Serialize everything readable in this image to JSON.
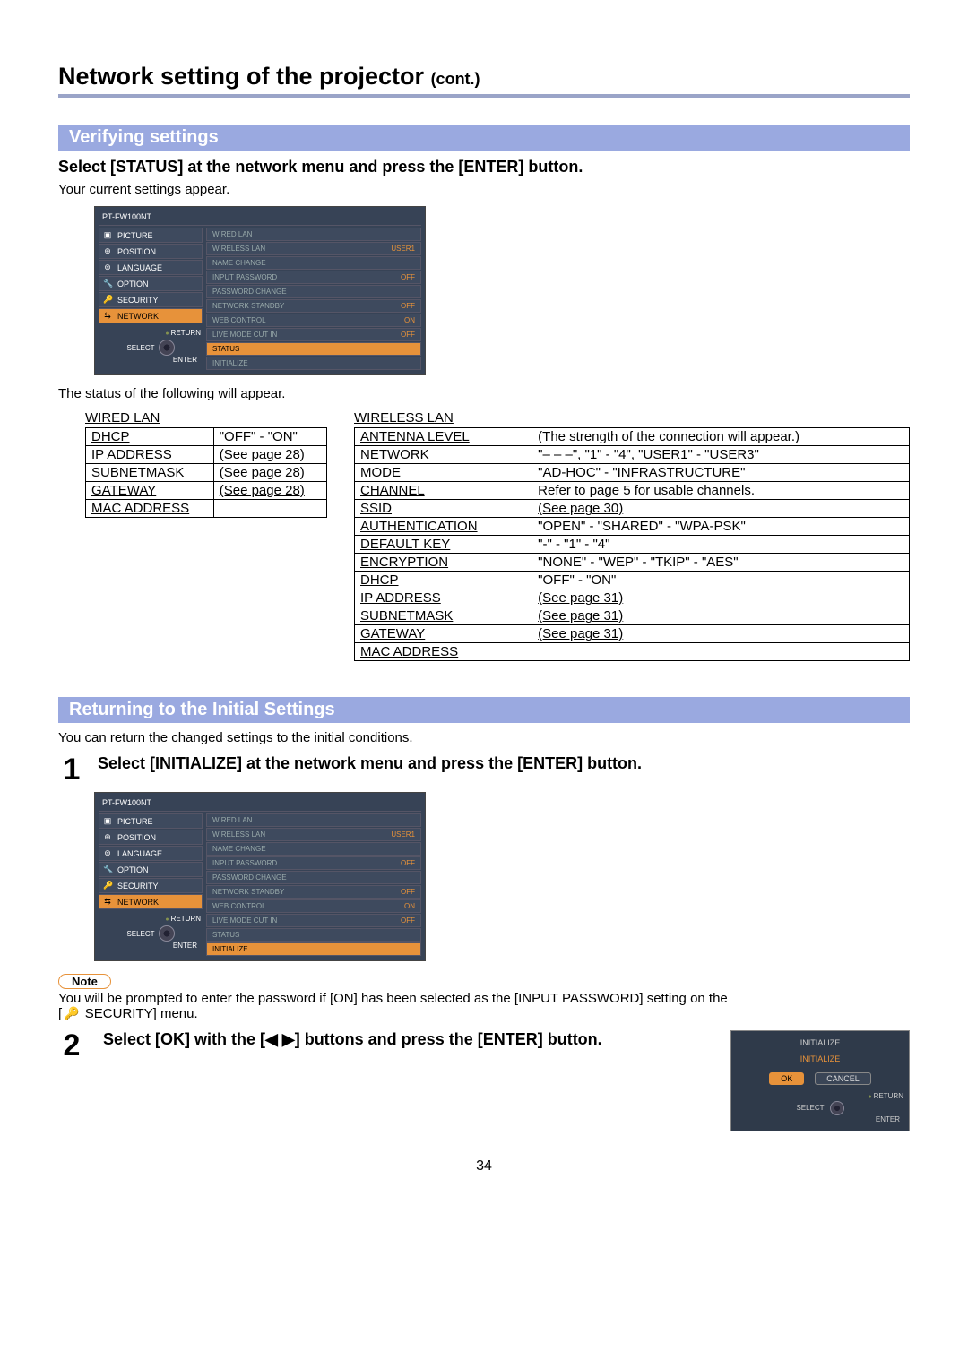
{
  "page": {
    "title": "Network setting of the projector",
    "cont": "(cont.)",
    "number": "34"
  },
  "verify": {
    "heading": "Verifying settings",
    "instruction": "Select [STATUS] at the network menu and press the [ENTER] button.",
    "text1": "Your current settings appear.",
    "text2": "The status of the following will appear."
  },
  "osd": {
    "title": "PT-FW100NT",
    "left": [
      {
        "icon": "▣",
        "label": "PICTURE"
      },
      {
        "icon": "⊕",
        "label": "POSITION"
      },
      {
        "icon": "⊜",
        "label": "LANGUAGE"
      },
      {
        "icon": "🔧",
        "label": "OPTION"
      },
      {
        "icon": "🔑",
        "label": "SECURITY"
      },
      {
        "icon": "⇆",
        "label": "NETWORK"
      }
    ],
    "active_index": 5,
    "right1": [
      {
        "label": "WIRED LAN",
        "val": ""
      },
      {
        "label": "WIRELESS LAN",
        "val": "USER1"
      },
      {
        "label": "NAME CHANGE",
        "val": ""
      },
      {
        "label": "INPUT PASSWORD",
        "val": "OFF"
      },
      {
        "label": "PASSWORD CHANGE",
        "val": ""
      },
      {
        "label": "NETWORK STANDBY",
        "val": "OFF"
      },
      {
        "label": "WEB CONTROL",
        "val": "ON"
      },
      {
        "label": "LIVE MODE CUT IN",
        "val": "OFF"
      },
      {
        "label": "STATUS",
        "val": ""
      },
      {
        "label": "INITIALIZE",
        "val": ""
      }
    ],
    "active_right1": 8,
    "active_right2": 9,
    "return": "RETURN",
    "select": "SELECT",
    "enter": "ENTER"
  },
  "wired": {
    "caption": "WIRED LAN",
    "rows": [
      {
        "k": "DHCP",
        "v": "\"OFF\" - \"ON\""
      },
      {
        "k": "IP ADDRESS",
        "v": "(See page 28)"
      },
      {
        "k": "SUBNETMASK",
        "v": "(See page 28)"
      },
      {
        "k": "GATEWAY",
        "v": "(See page 28)"
      },
      {
        "k": "MAC ADDRESS",
        "v": ""
      }
    ]
  },
  "wireless": {
    "caption": "WIRELESS LAN",
    "rows": [
      {
        "k": "ANTENNA LEVEL",
        "v": "(The strength of the connection will appear.)"
      },
      {
        "k": "NETWORK",
        "v": "\"– – –\", \"1\" - \"4\", \"USER1\" - \"USER3\""
      },
      {
        "k": "MODE",
        "v": "\"AD-HOC\" - \"INFRASTRUCTURE\""
      },
      {
        "k": "CHANNEL",
        "v": "Refer to page 5 for usable channels."
      },
      {
        "k": "SSID",
        "v": "(See page 30)"
      },
      {
        "k": "AUTHENTICATION",
        "v": "\"OPEN\" - \"SHARED\" - \"WPA-PSK\""
      },
      {
        "k": "DEFAULT KEY",
        "v": "\"-\" - \"1\" - \"4\""
      },
      {
        "k": "ENCRYPTION",
        "v": "\"NONE\" - \"WEP\" - \"TKIP\" - \"AES\""
      },
      {
        "k": "DHCP",
        "v": "\"OFF\" - \"ON\""
      },
      {
        "k": "IP ADDRESS",
        "v": "(See page 31)"
      },
      {
        "k": "SUBNETMASK",
        "v": "(See page 31)"
      },
      {
        "k": "GATEWAY",
        "v": "(See page 31)"
      },
      {
        "k": "MAC ADDRESS",
        "v": ""
      }
    ]
  },
  "return_sec": {
    "heading": "Returning to the Initial Settings",
    "text": "You can return the changed settings to the initial conditions.",
    "step1_num": "1",
    "step1": "Select [INITIALIZE] at the network menu and press the [ENTER] button.",
    "note_label": "Note",
    "note_text_a": "You will be prompted to enter the password if [ON] has been selected as the [INPUT PASSWORD] setting on the",
    "note_text_b": " SECURITY] menu.",
    "bracket": "[",
    "step2_num": "2",
    "step2": "Select [OK] with the [◀ ▶] buttons and press the [ENTER] button."
  },
  "init_dialog": {
    "title": "INITIALIZE",
    "subtitle": "INITIALIZE",
    "ok": "OK",
    "cancel": "CANCEL",
    "return": "RETURN",
    "select": "SELECT",
    "enter": "ENTER"
  }
}
